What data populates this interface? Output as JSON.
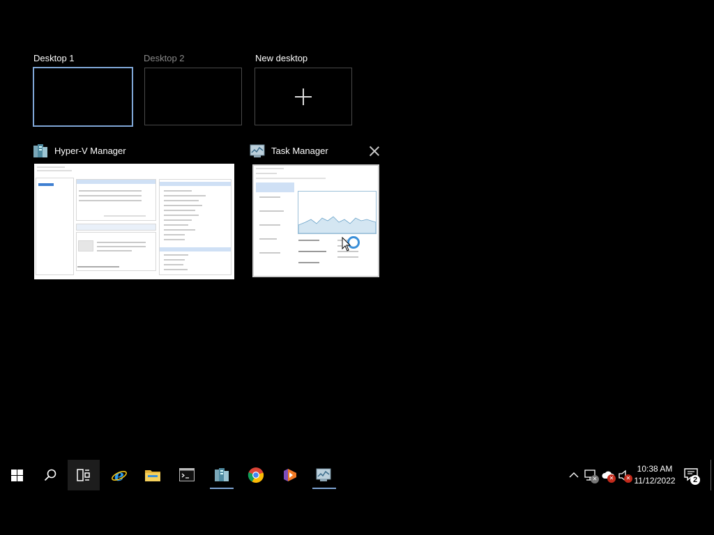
{
  "desktops": [
    {
      "label": "Desktop 1",
      "active": true
    },
    {
      "label": "Desktop 2",
      "active": false
    },
    {
      "label": "New desktop",
      "icon": "plus-icon"
    }
  ],
  "windows": [
    {
      "title": "Hyper-V Manager",
      "icon": "hyper-v-manager-icon"
    },
    {
      "title": "Task Manager",
      "icon": "task-manager-icon",
      "close_icon": "close-icon"
    }
  ],
  "taskbar": {
    "buttons": [
      {
        "name": "start-button",
        "icon": "windows-logo-icon"
      },
      {
        "name": "search-button",
        "icon": "search-icon"
      },
      {
        "name": "task-view-button",
        "icon": "task-view-icon"
      },
      {
        "name": "internet-explorer-button",
        "icon": "internet-explorer-icon"
      },
      {
        "name": "file-explorer-button",
        "icon": "folder-icon"
      },
      {
        "name": "command-prompt-button",
        "icon": "command-prompt-icon"
      },
      {
        "name": "hyper-v-manager-button",
        "icon": "hyper-v-manager-icon"
      },
      {
        "name": "chrome-button",
        "icon": "chrome-icon"
      },
      {
        "name": "visual-studio-button",
        "icon": "visual-studio-icon"
      },
      {
        "name": "task-manager-button",
        "icon": "task-manager-icon"
      }
    ],
    "tray": {
      "time": "10:38 AM",
      "date": "11/12/2022",
      "notification_count": "2"
    }
  },
  "colors": {
    "background": "#000000",
    "accent": "#7fa6d6",
    "error_badge": "#c42b1c"
  }
}
